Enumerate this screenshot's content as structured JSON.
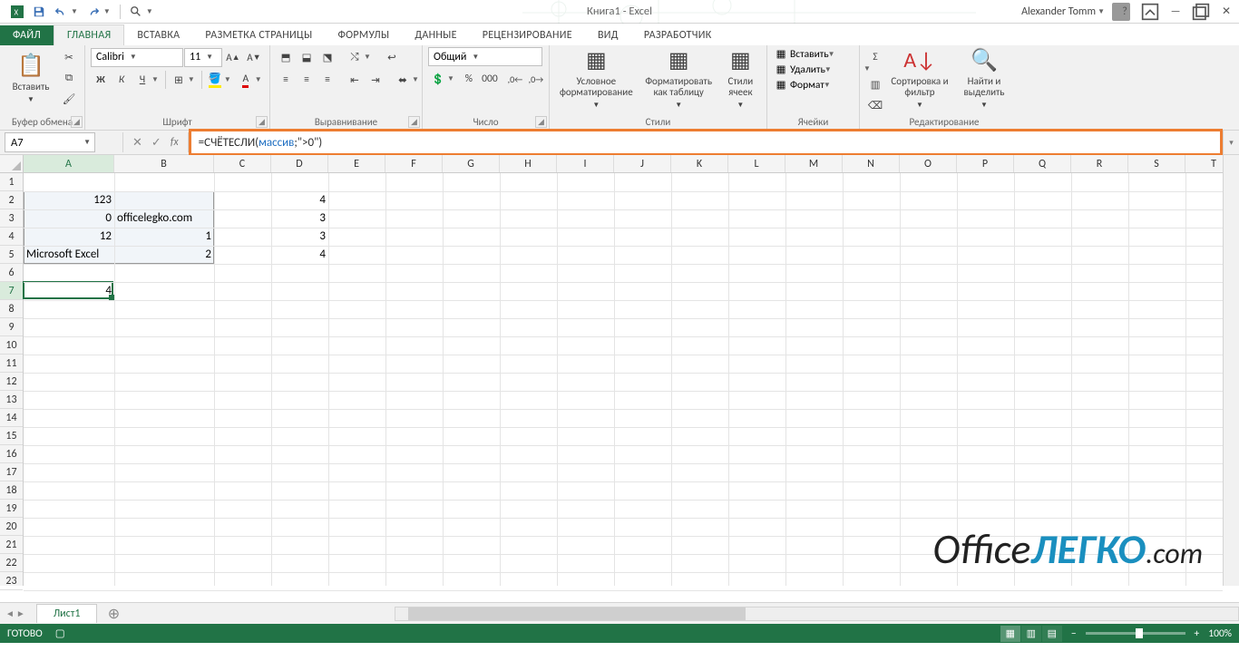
{
  "title": "Книга1 - Excel",
  "user": "Alexander Tomm",
  "qat": {
    "save": "save-icon",
    "undo": "undo-icon",
    "redo": "redo-icon",
    "preview": "print-preview-icon"
  },
  "tabs": {
    "file": "ФАЙЛ",
    "home": "ГЛАВНАЯ",
    "insert": "ВСТАВКА",
    "layout": "РАЗМЕТКА СТРАНИЦЫ",
    "formulas": "ФОРМУЛЫ",
    "data": "ДАННЫЕ",
    "review": "РЕЦЕНЗИРОВАНИЕ",
    "view": "ВИД",
    "developer": "РАЗРАБОТЧИК"
  },
  "ribbon": {
    "clipboard": {
      "paste": "Вставить",
      "label": "Буфер обмена"
    },
    "font": {
      "name": "Calibri",
      "size": "11",
      "bold": "Ж",
      "italic": "К",
      "underline": "Ч",
      "label": "Шрифт"
    },
    "align": {
      "label": "Выравнивание"
    },
    "number": {
      "format": "Общий",
      "label": "Число"
    },
    "styles": {
      "cond": "Условное форматирование",
      "table": "Форматировать как таблицу",
      "cell": "Стили ячеек",
      "label": "Стили"
    },
    "cells": {
      "insert": "Вставить",
      "delete": "Удалить",
      "format": "Формат",
      "label": "Ячейки"
    },
    "editing": {
      "sort": "Сортировка и фильтр",
      "find": "Найти и выделить",
      "label": "Редактирование"
    }
  },
  "namebox": "A7",
  "formula": {
    "prefix": "=СЧЁТЕСЛИ(",
    "arg": "массив",
    "suffix": ";\">0\")"
  },
  "columns": [
    "A",
    "B",
    "C",
    "D",
    "E",
    "F",
    "G",
    "H",
    "I",
    "J",
    "K",
    "L",
    "M",
    "N",
    "O",
    "P",
    "Q",
    "R",
    "S",
    "T"
  ],
  "rows": 23,
  "cells": {
    "A2": "123",
    "B2": "",
    "D2": "4",
    "A3": "0",
    "B3": "officelegko.com",
    "D3": "3",
    "A4": "12",
    "B4": "1",
    "D4": "3",
    "A5": "Microsoft Excel",
    "B5": "2",
    "D5": "4",
    "A7": "4"
  },
  "selected_range": "A2:B5",
  "active_cell": "A7",
  "sheet": "Лист1",
  "status": "ГОТОВО",
  "zoom": "100%",
  "watermark": {
    "p1": "Office",
    "p2": "ЛЕГКО",
    "p3": ".com"
  }
}
